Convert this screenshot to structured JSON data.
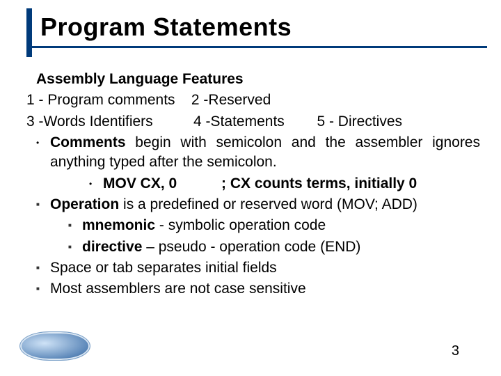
{
  "title": "Program Statements",
  "subheading": "Assembly Language Features",
  "numbered": {
    "line1_a": "1 - Program comments",
    "line1_b": "2 -Reserved",
    "line2_a": "3 -Words Identifiers",
    "line2_b": "4 -Statements",
    "line2_c": "5 - Directives"
  },
  "bullets": {
    "comments_pre": "Comments",
    "comments_post": " begin with semicolon and the assembler ignores anything typed after the semicolon.",
    "example_left": "MOV CX, 0",
    "example_right": "; CX counts terms, initially 0",
    "operation_pre": "Operation",
    "operation_post": " is a predefined or reserved word (MOV; ADD)",
    "mnemonic_pre": "mnemonic",
    "mnemonic_post": " - symbolic operation code",
    "directive_pre": "directive",
    "directive_post": " – pseudo - operation code (END)",
    "space": "Space or tab separates initial fields",
    "case": "Most assemblers are not case sensitive"
  },
  "page_number": "3"
}
